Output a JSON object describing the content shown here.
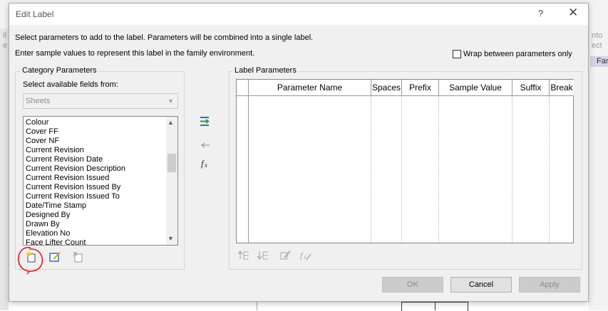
{
  "background": {
    "left_text_1": "il",
    "left_text_2": "e",
    "right_text_1": "nto",
    "right_text_2": "ect",
    "right_tab": "Far"
  },
  "dialog": {
    "title": "Edit Label",
    "help_glyph": "?",
    "close_glyph": "✕",
    "instruction_1": "Select parameters to add to the label.  Parameters will be combined into a single label.",
    "instruction_2": "Enter sample values to represent this label in the family environment.",
    "wrap_checkbox_label": "Wrap between parameters only",
    "wrap_checked": false
  },
  "category": {
    "group_title": "Category Parameters",
    "select_label": "Select available fields from:",
    "combo_value": "Sheets",
    "items": [
      "Colour",
      "Cover FF",
      "Cover NF",
      "Current Revision",
      "Current Revision Date",
      "Current Revision Description",
      "Current Revision Issued",
      "Current Revision Issued By",
      "Current Revision Issued To",
      "Date/Time Stamp",
      "Designed By",
      "Drawn By",
      "Elevation No",
      "Face Lifter Count"
    ]
  },
  "label_params": {
    "group_title": "Label Parameters",
    "columns": [
      "Parameter Name",
      "Spaces",
      "Prefix",
      "Sample Value",
      "Suffix",
      "Break"
    ]
  },
  "buttons": {
    "ok": "OK",
    "cancel": "Cancel",
    "apply": "Apply"
  },
  "icons": {
    "add_parameter": "add-parameter-icon",
    "remove_parameter": "remove-parameter-icon",
    "edit_formula": "fx-icon",
    "new_parameter": "new-parameter-icon",
    "edit_parameter": "edit-parameter-icon",
    "delete_parameter": "delete-parameter-icon",
    "move_up": "move-up-icon",
    "move_down": "move-down-icon",
    "sample_value": "sample-value-icon",
    "fx_sample": "fx-sample-icon"
  },
  "colors": {
    "accent_green": "#2e9b44",
    "accent_blue": "#2f6fbd",
    "annotation_red": "#e0191e"
  }
}
